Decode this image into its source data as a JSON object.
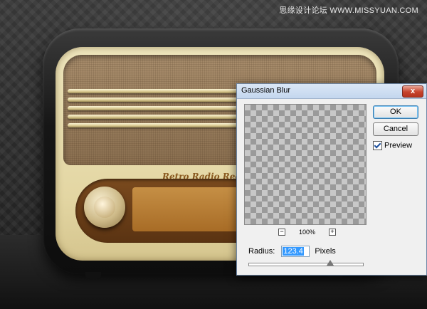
{
  "watermark": "思缘设计论坛 WWW.MISSYUAN.COM",
  "radio": {
    "dial_title": "Retro Radio Receiv"
  },
  "dialog": {
    "title": "Gaussian Blur",
    "close_label": "x",
    "ok_label": "OK",
    "cancel_label": "Cancel",
    "preview_label": "Preview",
    "preview_checked": true,
    "zoom_out_label": "−",
    "zoom_in_label": "+",
    "zoom_percent": "100%",
    "radius_label": "Radius:",
    "radius_value": "123.4",
    "radius_unit": "Pixels",
    "slider_fraction": 0.72
  }
}
